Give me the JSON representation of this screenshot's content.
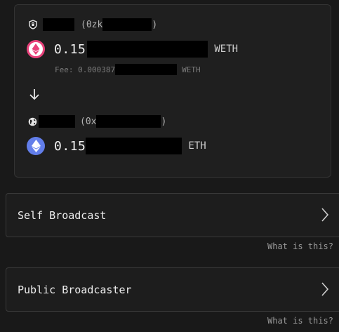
{
  "source": {
    "account_paren": "(0zk",
    "account_close": ")",
    "amount": "0.15",
    "symbol": "WETH",
    "fee_label": "Fee: 0.000387",
    "fee_symbol": "WETH"
  },
  "destination": {
    "account_paren": "(0x",
    "account_close": ")",
    "amount": "0.15",
    "symbol": "ETH"
  },
  "options": [
    {
      "label": "Self Broadcast",
      "help": "What is this?"
    },
    {
      "label": "Public Broadcaster",
      "help": "What is this?"
    }
  ],
  "colors": {
    "weth_ring": "#e8417a",
    "eth": "#627eea"
  }
}
